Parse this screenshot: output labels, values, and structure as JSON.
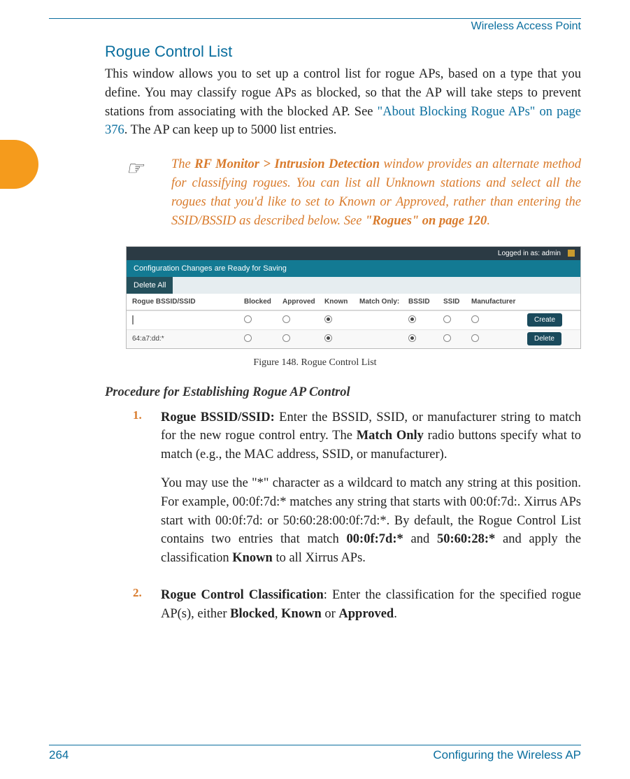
{
  "header": {
    "title": "Wireless Access Point"
  },
  "section": {
    "heading": "Rogue Control List"
  },
  "intro": {
    "p1a": "This window allows you to set up a control list for rogue APs, based on a type that you define. You may classify rogue APs as blocked, so that the AP will take steps to prevent stations from associating with the blocked AP. See ",
    "link1": "\"About Blocking Rogue APs\" on page 376",
    "p1b": ". The AP can keep up to 5000 list entries."
  },
  "note": {
    "t1": "The ",
    "b1": "RF Monitor > Intrusion Detection",
    "t2": " window provides an alternate method for classifying rogues. You can list all Unknown stations and select all the rogues that you'd like to set to Known or Approved, rather than entering the SSID/BSSID as described below. See ",
    "b2": "\"Rogues\" on page 120",
    "t3": "."
  },
  "figure": {
    "login": "Logged in as: admin",
    "banner": "Configuration Changes are Ready for Saving",
    "deleteAll": "Delete All",
    "cols": {
      "c1": "Rogue BSSID/SSID",
      "c2": "Blocked",
      "c3": "Approved",
      "c4": "Known",
      "c5": "Match Only:",
      "c6": "BSSID",
      "c7": "SSID",
      "c8": "Manufacturer"
    },
    "row2id": "64:a7:dd:*",
    "create": "Create",
    "delete": "Delete",
    "caption": "Figure 148. Rogue Control List"
  },
  "procHeading": "Procedure for Establishing Rogue AP Control",
  "steps": {
    "n1": "1.",
    "s1a": "Rogue BSSID/SSID:",
    "s1b": " Enter the BSSID, SSID, or manufacturer string to match for the new rogue control entry. The ",
    "s1c": "Match Only",
    "s1d": " radio buttons specify what to match (e.g., the MAC address, SSID, or manufacturer).",
    "s1p2a": "You may use the \"*\" character as a wildcard to match any string at this position. For example, 00:0f:7d:* matches any string that starts with 00:0f:7d:. Xirrus APs start with 00:0f:7d: or 50:60:28:00:0f:7d:*. By default, the Rogue Control List contains two entries that match ",
    "s1p2b": "00:0f:7d:*",
    "s1p2c": " and ",
    "s1p2d": "50:60:28:*",
    "s1p2e": " and apply the classification ",
    "s1p2f": "Known",
    "s1p2g": " to all Xirrus APs.",
    "n2": "2.",
    "s2a": "Rogue Control Classification",
    "s2b": ": Enter the classification for the specified rogue AP(s), either ",
    "s2c": "Blocked",
    "s2d": ", ",
    "s2e": "Known",
    "s2f": " or ",
    "s2g": "Approved",
    "s2h": "."
  },
  "footer": {
    "page": "264",
    "section": "Configuring the Wireless AP"
  }
}
